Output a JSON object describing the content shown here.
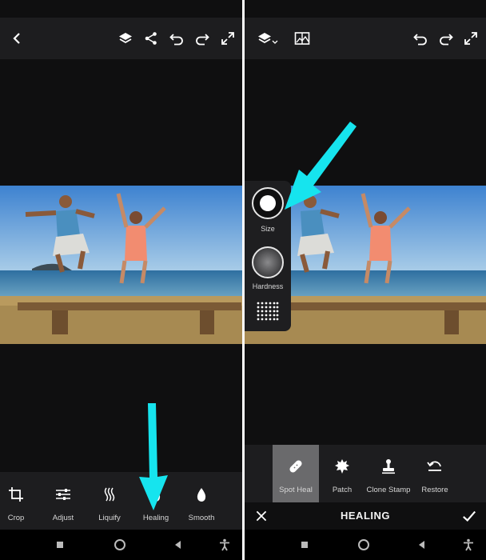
{
  "left": {
    "tools": [
      {
        "label": "Crop",
        "icon": "crop-icon"
      },
      {
        "label": "Adjust",
        "icon": "adjust-icon"
      },
      {
        "label": "Liquify",
        "icon": "liquify-icon"
      },
      {
        "label": "Healing",
        "icon": "healing-icon"
      },
      {
        "label": "Smooth",
        "icon": "smooth-icon"
      }
    ]
  },
  "right": {
    "brush": {
      "size_label": "Size",
      "hardness_label": "Hardness"
    },
    "heal_tools": [
      {
        "label": "Spot Heal",
        "active": true
      },
      {
        "label": "Patch",
        "active": false
      },
      {
        "label": "Clone Stamp",
        "active": false
      },
      {
        "label": "Restore",
        "active": false
      }
    ],
    "mode_title": "HEALING"
  },
  "colors": {
    "arrow": "#16e4ee",
    "toolbar": "#1d1d1f",
    "canvas_bg": "#0f0f10",
    "active_tool": "#6a6a6c"
  }
}
